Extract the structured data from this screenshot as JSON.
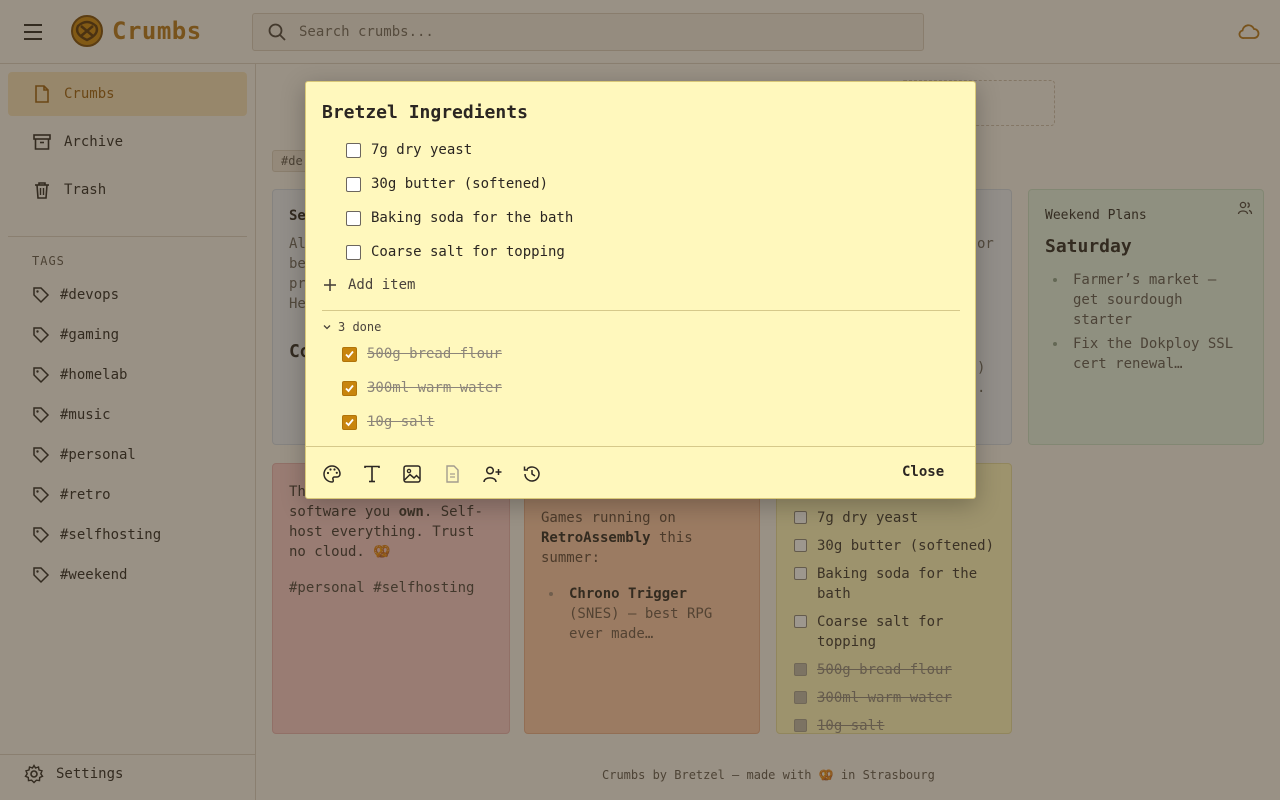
{
  "header": {
    "app_name": "Crumbs",
    "search_placeholder": "Search crumbs..."
  },
  "sidebar": {
    "nav": [
      {
        "label": "Crumbs",
        "icon": "note-icon",
        "active": true
      },
      {
        "label": "Archive",
        "icon": "archive-icon",
        "active": false
      },
      {
        "label": "Trash",
        "icon": "trash-icon",
        "active": false
      }
    ],
    "tags_heading": "TAGS",
    "tags": [
      "#devops",
      "#gaming",
      "#homelab",
      "#music",
      "#personal",
      "#retro",
      "#selfhosting",
      "#weekend"
    ],
    "settings_label": "Settings"
  },
  "background": {
    "tag_chip": "#de",
    "card_blue_title": "Se",
    "card_blue_text": "Al\nbe\npr\nHe",
    "card_blue_big": "Co",
    "card_blue2_frag1": "or",
    "card_blue2_frag2": ")",
    "card_blue2_frag3": ".",
    "weekend": {
      "title": "Weekend Plans",
      "heading": "Saturday",
      "items": [
        "Farmer’s market — get sourdough starter",
        "Fix the Dokploy SSL cert renewal…"
      ]
    },
    "pink": {
      "text_before": "Th",
      "text_line1": "software you ",
      "text_bold": "own",
      "text_after": ". Self-host everything. Trust no cloud. 🥨",
      "tags": "#personal #selfhosting"
    },
    "orange": {
      "text_before": "Games running on ",
      "text_bold": "RetroAssembly",
      "text_after": " this summer:",
      "item_bold": "Chrono Trigger",
      "item_rest": " (SNES) — best RPG ever made…"
    },
    "yellow_items": [
      {
        "label": "7g dry yeast",
        "done": false
      },
      {
        "label": "30g butter (softened)",
        "done": false
      },
      {
        "label": "Baking soda for the bath",
        "done": false
      },
      {
        "label": "Coarse salt for topping",
        "done": false
      },
      {
        "label": "500g bread flour",
        "done": true
      },
      {
        "label": "300ml warm water",
        "done": true
      },
      {
        "label": "10g salt",
        "done": true
      }
    ],
    "footer": "Crumbs by Bretzel — made with 🥨 in Strasbourg"
  },
  "modal": {
    "title": "Bretzel Ingredients",
    "open_items": [
      "7g dry yeast",
      "30g butter (softened)",
      "Baking soda for the bath",
      "Coarse salt for topping"
    ],
    "add_item_label": "Add item",
    "done_toggle_label": "3 done",
    "done_items": [
      "500g bread flour",
      "300ml warm water",
      "10g salt"
    ],
    "close_label": "Close"
  },
  "colors": {
    "accent": "#c8850d",
    "brand": "#b5761a"
  }
}
